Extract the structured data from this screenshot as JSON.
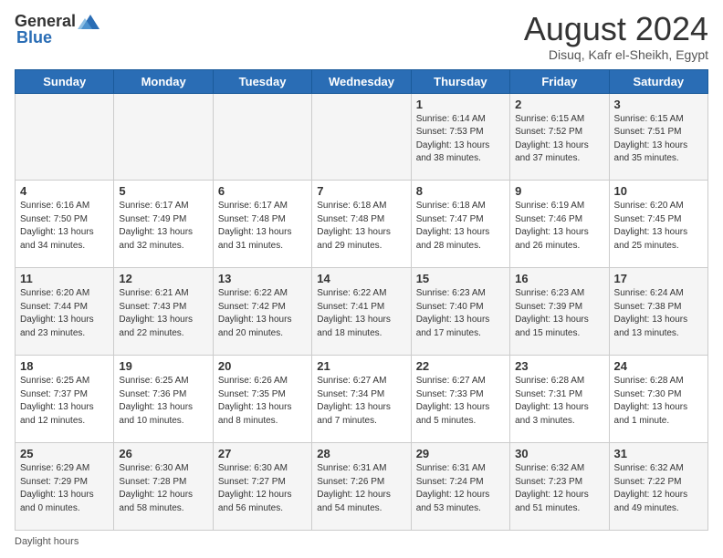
{
  "logo": {
    "general": "General",
    "blue": "Blue"
  },
  "header": {
    "month": "August 2024",
    "location": "Disuq, Kafr el-Sheikh, Egypt"
  },
  "days_of_week": [
    "Sunday",
    "Monday",
    "Tuesday",
    "Wednesday",
    "Thursday",
    "Friday",
    "Saturday"
  ],
  "weeks": [
    [
      {
        "day": "",
        "info": ""
      },
      {
        "day": "",
        "info": ""
      },
      {
        "day": "",
        "info": ""
      },
      {
        "day": "",
        "info": ""
      },
      {
        "day": "1",
        "info": "Sunrise: 6:14 AM\nSunset: 7:53 PM\nDaylight: 13 hours\nand 38 minutes."
      },
      {
        "day": "2",
        "info": "Sunrise: 6:15 AM\nSunset: 7:52 PM\nDaylight: 13 hours\nand 37 minutes."
      },
      {
        "day": "3",
        "info": "Sunrise: 6:15 AM\nSunset: 7:51 PM\nDaylight: 13 hours\nand 35 minutes."
      }
    ],
    [
      {
        "day": "4",
        "info": "Sunrise: 6:16 AM\nSunset: 7:50 PM\nDaylight: 13 hours\nand 34 minutes."
      },
      {
        "day": "5",
        "info": "Sunrise: 6:17 AM\nSunset: 7:49 PM\nDaylight: 13 hours\nand 32 minutes."
      },
      {
        "day": "6",
        "info": "Sunrise: 6:17 AM\nSunset: 7:48 PM\nDaylight: 13 hours\nand 31 minutes."
      },
      {
        "day": "7",
        "info": "Sunrise: 6:18 AM\nSunset: 7:48 PM\nDaylight: 13 hours\nand 29 minutes."
      },
      {
        "day": "8",
        "info": "Sunrise: 6:18 AM\nSunset: 7:47 PM\nDaylight: 13 hours\nand 28 minutes."
      },
      {
        "day": "9",
        "info": "Sunrise: 6:19 AM\nSunset: 7:46 PM\nDaylight: 13 hours\nand 26 minutes."
      },
      {
        "day": "10",
        "info": "Sunrise: 6:20 AM\nSunset: 7:45 PM\nDaylight: 13 hours\nand 25 minutes."
      }
    ],
    [
      {
        "day": "11",
        "info": "Sunrise: 6:20 AM\nSunset: 7:44 PM\nDaylight: 13 hours\nand 23 minutes."
      },
      {
        "day": "12",
        "info": "Sunrise: 6:21 AM\nSunset: 7:43 PM\nDaylight: 13 hours\nand 22 minutes."
      },
      {
        "day": "13",
        "info": "Sunrise: 6:22 AM\nSunset: 7:42 PM\nDaylight: 13 hours\nand 20 minutes."
      },
      {
        "day": "14",
        "info": "Sunrise: 6:22 AM\nSunset: 7:41 PM\nDaylight: 13 hours\nand 18 minutes."
      },
      {
        "day": "15",
        "info": "Sunrise: 6:23 AM\nSunset: 7:40 PM\nDaylight: 13 hours\nand 17 minutes."
      },
      {
        "day": "16",
        "info": "Sunrise: 6:23 AM\nSunset: 7:39 PM\nDaylight: 13 hours\nand 15 minutes."
      },
      {
        "day": "17",
        "info": "Sunrise: 6:24 AM\nSunset: 7:38 PM\nDaylight: 13 hours\nand 13 minutes."
      }
    ],
    [
      {
        "day": "18",
        "info": "Sunrise: 6:25 AM\nSunset: 7:37 PM\nDaylight: 13 hours\nand 12 minutes."
      },
      {
        "day": "19",
        "info": "Sunrise: 6:25 AM\nSunset: 7:36 PM\nDaylight: 13 hours\nand 10 minutes."
      },
      {
        "day": "20",
        "info": "Sunrise: 6:26 AM\nSunset: 7:35 PM\nDaylight: 13 hours\nand 8 minutes."
      },
      {
        "day": "21",
        "info": "Sunrise: 6:27 AM\nSunset: 7:34 PM\nDaylight: 13 hours\nand 7 minutes."
      },
      {
        "day": "22",
        "info": "Sunrise: 6:27 AM\nSunset: 7:33 PM\nDaylight: 13 hours\nand 5 minutes."
      },
      {
        "day": "23",
        "info": "Sunrise: 6:28 AM\nSunset: 7:31 PM\nDaylight: 13 hours\nand 3 minutes."
      },
      {
        "day": "24",
        "info": "Sunrise: 6:28 AM\nSunset: 7:30 PM\nDaylight: 13 hours\nand 1 minute."
      }
    ],
    [
      {
        "day": "25",
        "info": "Sunrise: 6:29 AM\nSunset: 7:29 PM\nDaylight: 13 hours\nand 0 minutes."
      },
      {
        "day": "26",
        "info": "Sunrise: 6:30 AM\nSunset: 7:28 PM\nDaylight: 12 hours\nand 58 minutes."
      },
      {
        "day": "27",
        "info": "Sunrise: 6:30 AM\nSunset: 7:27 PM\nDaylight: 12 hours\nand 56 minutes."
      },
      {
        "day": "28",
        "info": "Sunrise: 6:31 AM\nSunset: 7:26 PM\nDaylight: 12 hours\nand 54 minutes."
      },
      {
        "day": "29",
        "info": "Sunrise: 6:31 AM\nSunset: 7:24 PM\nDaylight: 12 hours\nand 53 minutes."
      },
      {
        "day": "30",
        "info": "Sunrise: 6:32 AM\nSunset: 7:23 PM\nDaylight: 12 hours\nand 51 minutes."
      },
      {
        "day": "31",
        "info": "Sunrise: 6:32 AM\nSunset: 7:22 PM\nDaylight: 12 hours\nand 49 minutes."
      }
    ]
  ],
  "footer": {
    "label": "Daylight hours"
  },
  "colors": {
    "header_bg": "#2a6db5",
    "odd_row": "#f5f5f5",
    "even_row": "#ffffff"
  }
}
